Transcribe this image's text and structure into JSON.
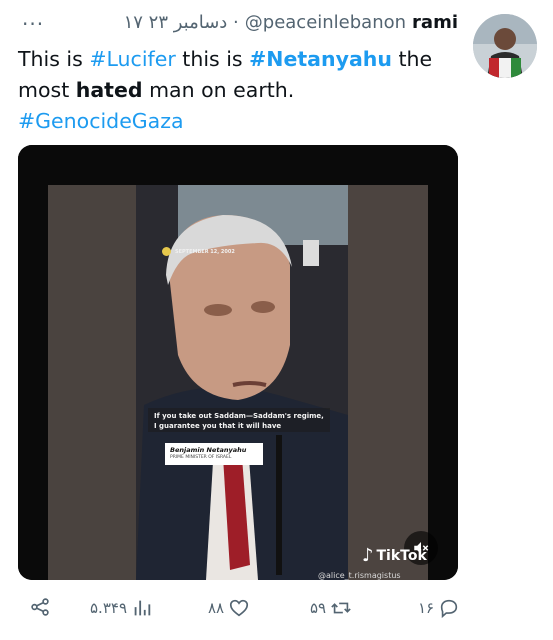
{
  "tweet": {
    "author_name": "rami",
    "handle": "@peaceinlebanon",
    "date": "۱۷ دسامبر ۲۳ ·",
    "text_parts": {
      "p1": "This is ",
      "tag1": "#Lucifer",
      "p2": " this is ",
      "tag2": "#Netanyahu",
      "p3": " the most ",
      "bold1": "hated",
      "p4": " man on earth.",
      "tag3": "#GenocideGaza"
    }
  },
  "media": {
    "date_stamp": "SEPTEMBER 12, 2002",
    "caption": "If you take out Saddam—Saddam's regime, I guarantee you that it will have",
    "name_card_name": "Benjamin Netanyahu",
    "name_card_title": "PRIME MINISTER OF ISRAEL",
    "watermark_logo": "TikTok",
    "watermark_user": "@alice_t.rismagistus",
    "sound_icon": "volume-off-icon"
  },
  "actions": {
    "replies": "۱۶",
    "retweets": "۵۹",
    "likes": "۸۸",
    "views": "۵.۳۴۹",
    "icons": [
      "reply-icon",
      "retweet-icon",
      "like-icon",
      "views-icon",
      "share-icon"
    ]
  },
  "colors": {
    "accent": "#1d9bf0",
    "muted": "#536471",
    "text": "#0f1419"
  }
}
